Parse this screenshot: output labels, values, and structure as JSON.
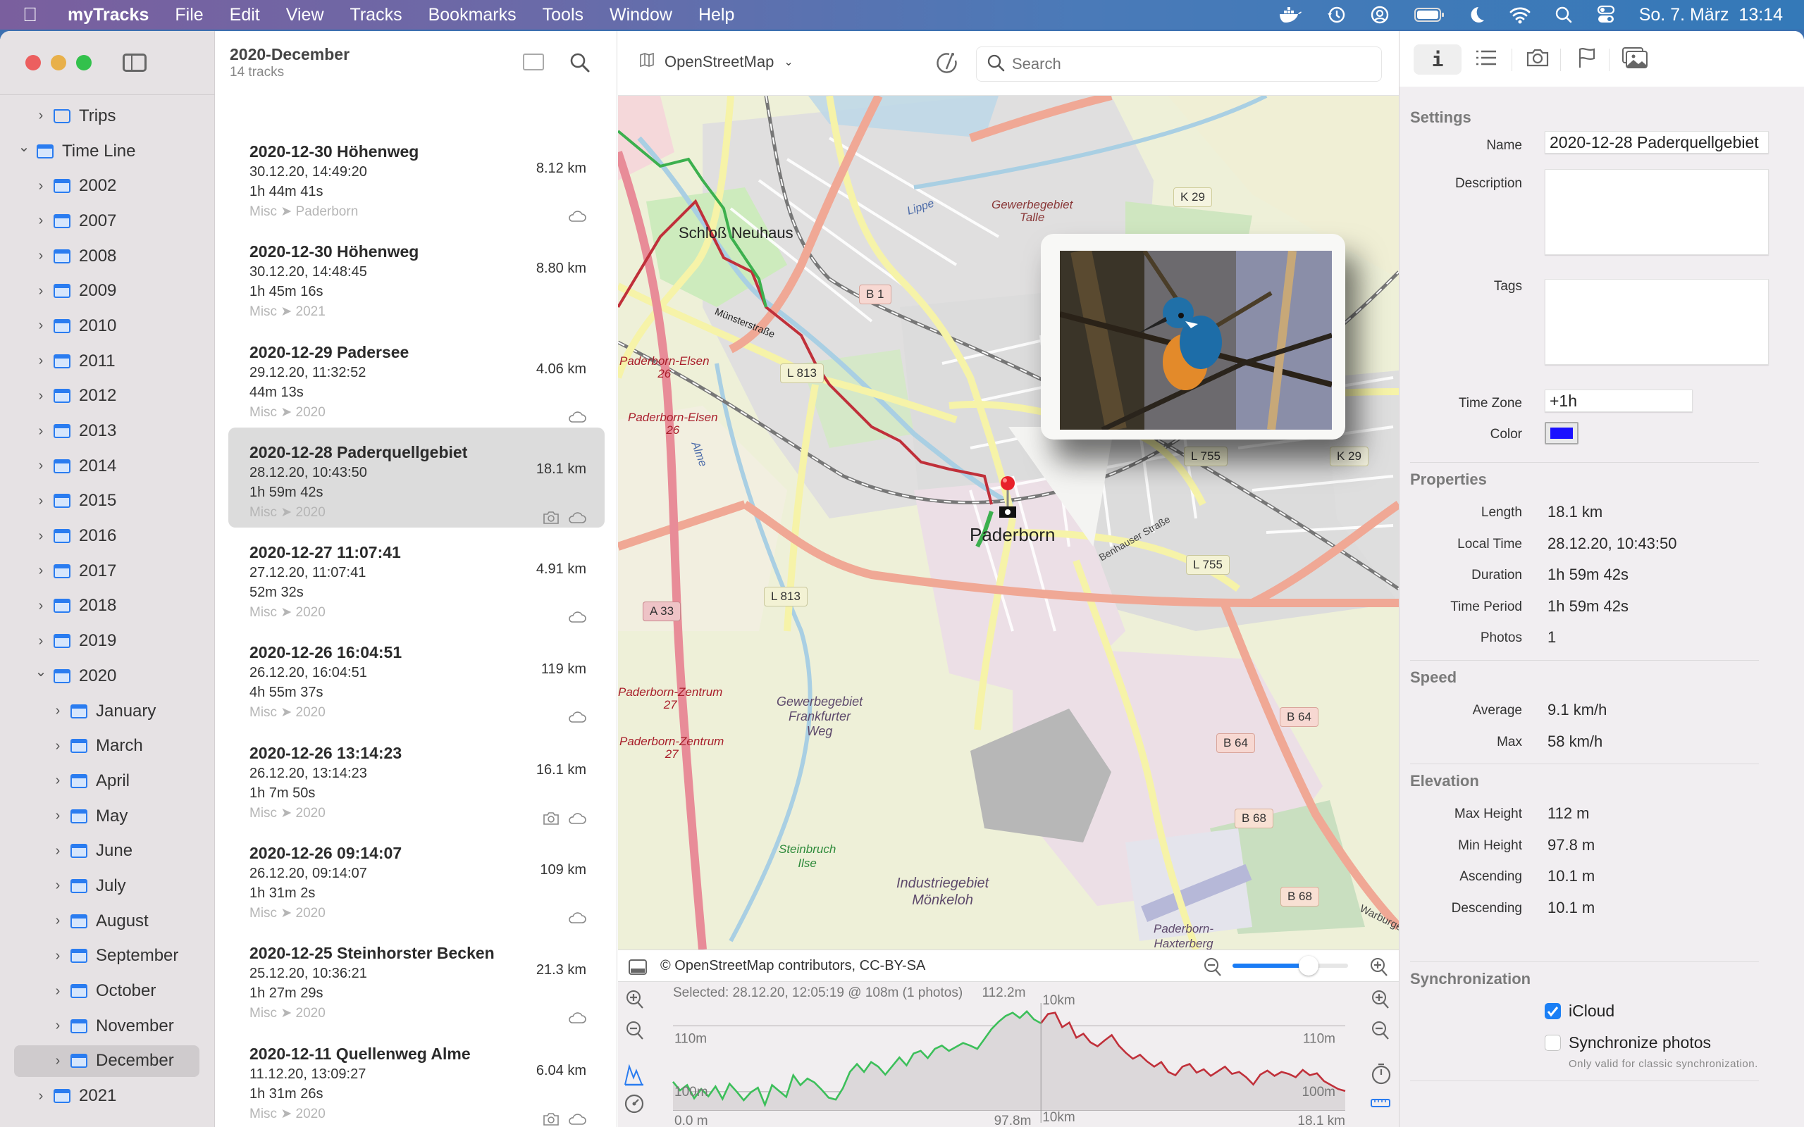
{
  "menubar": {
    "apple_icon": "apple-logo-icon",
    "items": [
      "myTracks",
      "File",
      "Edit",
      "View",
      "Tracks",
      "Bookmarks",
      "Tools",
      "Window",
      "Help"
    ],
    "status_icons": [
      "docker-icon",
      "time-machine-icon",
      "user-account-icon",
      "battery-icon",
      "do-not-disturb-moon-icon",
      "wifi-icon",
      "spotlight-search-icon",
      "control-center-icon"
    ],
    "clock": "So. 7. März  13:14"
  },
  "sidebar": {
    "items": [
      {
        "label": "Trips",
        "level": 1,
        "icon": "folder-icon",
        "expanded": false
      },
      {
        "label": "Time Line",
        "level": 0,
        "icon": "calendar-icon",
        "expanded": true
      },
      {
        "label": "2002",
        "level": 1,
        "icon": "calendar-icon",
        "expanded": false
      },
      {
        "label": "2007",
        "level": 1,
        "icon": "calendar-icon",
        "expanded": false
      },
      {
        "label": "2008",
        "level": 1,
        "icon": "calendar-icon",
        "expanded": false
      },
      {
        "label": "2009",
        "level": 1,
        "icon": "calendar-icon",
        "expanded": false
      },
      {
        "label": "2010",
        "level": 1,
        "icon": "calendar-icon",
        "expanded": false
      },
      {
        "label": "2011",
        "level": 1,
        "icon": "calendar-icon",
        "expanded": false
      },
      {
        "label": "2012",
        "level": 1,
        "icon": "calendar-icon",
        "expanded": false
      },
      {
        "label": "2013",
        "level": 1,
        "icon": "calendar-icon",
        "expanded": false
      },
      {
        "label": "2014",
        "level": 1,
        "icon": "calendar-icon",
        "expanded": false
      },
      {
        "label": "2015",
        "level": 1,
        "icon": "calendar-icon",
        "expanded": false
      },
      {
        "label": "2016",
        "level": 1,
        "icon": "calendar-icon",
        "expanded": false
      },
      {
        "label": "2017",
        "level": 1,
        "icon": "calendar-icon",
        "expanded": false
      },
      {
        "label": "2018",
        "level": 1,
        "icon": "calendar-icon",
        "expanded": false
      },
      {
        "label": "2019",
        "level": 1,
        "icon": "calendar-icon",
        "expanded": false
      },
      {
        "label": "2020",
        "level": 1,
        "icon": "calendar-icon",
        "expanded": true
      },
      {
        "label": "January",
        "level": 2,
        "icon": "calendar-icon",
        "expanded": false
      },
      {
        "label": "March",
        "level": 2,
        "icon": "calendar-icon",
        "expanded": false
      },
      {
        "label": "April",
        "level": 2,
        "icon": "calendar-icon",
        "expanded": false
      },
      {
        "label": "May",
        "level": 2,
        "icon": "calendar-icon",
        "expanded": false
      },
      {
        "label": "June",
        "level": 2,
        "icon": "calendar-icon",
        "expanded": false
      },
      {
        "label": "July",
        "level": 2,
        "icon": "calendar-icon",
        "expanded": false
      },
      {
        "label": "August",
        "level": 2,
        "icon": "calendar-icon",
        "expanded": false
      },
      {
        "label": "September",
        "level": 2,
        "icon": "calendar-icon",
        "expanded": false
      },
      {
        "label": "October",
        "level": 2,
        "icon": "calendar-icon",
        "expanded": false
      },
      {
        "label": "November",
        "level": 2,
        "icon": "calendar-icon",
        "expanded": false
      },
      {
        "label": "December",
        "level": 2,
        "icon": "calendar-icon",
        "expanded": false,
        "selected": true
      },
      {
        "label": "2021",
        "level": 1,
        "icon": "calendar-icon",
        "expanded": false
      }
    ]
  },
  "list": {
    "title": "2020-December",
    "subtitle": "14 tracks",
    "tracks": [
      {
        "title": "2020-12-30 Höhenweg",
        "date": "30.12.20, 14:49:20",
        "duration": "1h 44m 41s",
        "distance": "8.12 km",
        "category": "Misc ➤ Paderborn",
        "photo": false,
        "cloud": true
      },
      {
        "title": "2020-12-30 Höhenweg",
        "date": "30.12.20, 14:48:45",
        "duration": "1h 45m 16s",
        "distance": "8.80 km",
        "category": "Misc ➤ 2021",
        "photo": false,
        "cloud": false
      },
      {
        "title": "2020-12-29 Padersee",
        "date": "29.12.20, 11:32:52",
        "duration": "44m 13s",
        "distance": "4.06 km",
        "category": "Misc ➤ 2020",
        "photo": false,
        "cloud": true
      },
      {
        "title": "2020-12-28 Paderquellgebiet",
        "date": "28.12.20, 10:43:50",
        "duration": "1h 59m 42s",
        "distance": "18.1 km",
        "category": "Misc ➤ 2020",
        "photo": true,
        "cloud": true,
        "selected": true
      },
      {
        "title": "2020-12-27 11:07:41",
        "date": "27.12.20, 11:07:41",
        "duration": "52m 32s",
        "distance": "4.91 km",
        "category": "Misc ➤ 2020",
        "photo": false,
        "cloud": true
      },
      {
        "title": "2020-12-26 16:04:51",
        "date": "26.12.20, 16:04:51",
        "duration": "4h 55m 37s",
        "distance": "119 km",
        "category": "Misc ➤ 2020",
        "photo": false,
        "cloud": true
      },
      {
        "title": "2020-12-26 13:14:23",
        "date": "26.12.20, 13:14:23",
        "duration": "1h 7m 50s",
        "distance": "16.1 km",
        "category": "Misc ➤ 2020",
        "photo": true,
        "cloud": true
      },
      {
        "title": "2020-12-26 09:14:07",
        "date": "26.12.20, 09:14:07",
        "duration": "1h 31m 2s",
        "distance": "109 km",
        "category": "Misc ➤ 2020",
        "photo": false,
        "cloud": true
      },
      {
        "title": "2020-12-25 Steinhorster Becken",
        "date": "25.12.20, 10:36:21",
        "duration": "1h 27m 29s",
        "distance": "21.3 km",
        "category": "Misc ➤ 2020",
        "photo": false,
        "cloud": true
      },
      {
        "title": "2020-12-11 Quellenweg Alme",
        "date": "11.12.20, 13:09:27",
        "duration": "1h 31m 26s",
        "distance": "6.04 km",
        "category": "Misc ➤ 2020",
        "photo": true,
        "cloud": true
      }
    ]
  },
  "map": {
    "provider": "OpenStreetMap",
    "search_placeholder": "Search",
    "attribution": "© OpenStreetMap contributors, CC-BY-SA",
    "zoom_level_fraction": 0.66,
    "labels": {
      "schloss": "Schloß Neuhaus",
      "paderborn": "Paderborn",
      "elsen1": "Paderborn-Elsen\n26",
      "elsen2": "Paderborn-Elsen\n26",
      "zentrum1": "Paderborn-Zentrum\n27",
      "zentrum2": "Paderborn-Zentrum\n27",
      "talle": "Gewerbegebiet\nTalle",
      "frankfurter": "Gewerbegebiet\nFrankfurter\nWeg",
      "moenkeloh": "Industriegebiet\nMönkeloh",
      "steinbruch": "Steinbruch\nIlse",
      "airport": "Paderborn-\nHaxterberg",
      "muensterstr": "Münsterstraße",
      "benhauser": "Benhauser Straße",
      "lippe": "Lippe",
      "alme": "Alme",
      "warburger": "Warburger"
    },
    "shields": [
      "B 1",
      "L 813",
      "L 813",
      "A 33",
      "K 29",
      "K 29",
      "L 755",
      "L 755",
      "B 64",
      "B 64",
      "B 68",
      "B 68"
    ],
    "photo_popup": {
      "subject": "kingfisher-photo"
    }
  },
  "elevation": {
    "selected_text": "Selected: 28.12.20, 12:05:19 @ 108m (1 photos)",
    "max_label": "112.2m",
    "y_labels": {
      "upper_left": "110m",
      "upper_right": "110m",
      "lower_left": "100m",
      "lower_right": "100m"
    },
    "marker_label_top": "10km",
    "marker_label_bottom": "10km",
    "x_labels": {
      "start": "0.0 m",
      "mid": "97.8m",
      "end": "18.1 km"
    },
    "y_range_m": [
      97.8,
      112.2
    ],
    "x_range_km": [
      0,
      18.1
    ],
    "selected_km": 10,
    "ascending_color": "#3cbf5a",
    "descending_color": "#c0303a",
    "profile_m": [
      101.5,
      100.2,
      101.0,
      99.0,
      100.4,
      99.3,
      100.8,
      98.9,
      101.2,
      100.0,
      98.7,
      99.9,
      100.6,
      98.0,
      101.0,
      100.1,
      99.2,
      102.5,
      101.0,
      102.0,
      101.4,
      100.3,
      99.1,
      98.8,
      100.5,
      103.0,
      104.2,
      103.0,
      104.5,
      103.8,
      102.6,
      103.9,
      105.2,
      104.0,
      105.8,
      106.2,
      105.1,
      106.5,
      107.0,
      106.2,
      106.8,
      107.4,
      107.0,
      106.5,
      108.0,
      109.5,
      110.6,
      111.5,
      112.0,
      111.2,
      112.2,
      111.0,
      110.4,
      111.8,
      112.0,
      109.8,
      110.5,
      108.2,
      108.8,
      107.5,
      106.9,
      107.8,
      108.6,
      107.0,
      105.9,
      105.0,
      105.6,
      104.6,
      103.8,
      104.5,
      103.0,
      102.5,
      103.8,
      104.2,
      102.9,
      103.4,
      102.4,
      103.1,
      103.8,
      102.7,
      103.0,
      102.2,
      101.1,
      102.6,
      103.2,
      102.4,
      103.0,
      102.7,
      102.2,
      103.3,
      102.5,
      102.8,
      101.6,
      101.0,
      100.4,
      100.1
    ]
  },
  "inspector": {
    "tabs": [
      "info-icon",
      "list-icon",
      "camera-icon",
      "flag-icon",
      "photos-icon"
    ],
    "settings": {
      "title": "Settings",
      "name_label": "Name",
      "name_value": "2020-12-28 Paderquellgebiet",
      "description_label": "Description",
      "description_value": "",
      "tags_label": "Tags",
      "tags_value": "",
      "timezone_label": "Time Zone",
      "timezone_value": "+1h",
      "color_label": "Color",
      "color_value": "#1a10ff"
    },
    "properties": {
      "title": "Properties",
      "rows": [
        {
          "label": "Length",
          "value": "18.1 km"
        },
        {
          "label": "Local Time",
          "value": "28.12.20, 10:43:50"
        },
        {
          "label": "Duration",
          "value": "1h 59m 42s"
        },
        {
          "label": "Time Period",
          "value": "1h 59m 42s"
        },
        {
          "label": "Photos",
          "value": "1"
        }
      ]
    },
    "speed": {
      "title": "Speed",
      "rows": [
        {
          "label": "Average",
          "value": "9.1 km/h"
        },
        {
          "label": "Max",
          "value": "58 km/h"
        }
      ]
    },
    "elevation": {
      "title": "Elevation",
      "rows": [
        {
          "label": "Max Height",
          "value": "112 m"
        },
        {
          "label": "Min Height",
          "value": "97.8 m"
        },
        {
          "label": "Ascending",
          "value": "10.1 m"
        },
        {
          "label": "Descending",
          "value": "10.1 m"
        }
      ]
    },
    "sync": {
      "title": "Synchronization",
      "icloud_label": "iCloud",
      "icloud_checked": true,
      "photos_label": "Synchronize photos",
      "photos_checked": false,
      "hint": "Only valid for classic synchronization."
    }
  }
}
